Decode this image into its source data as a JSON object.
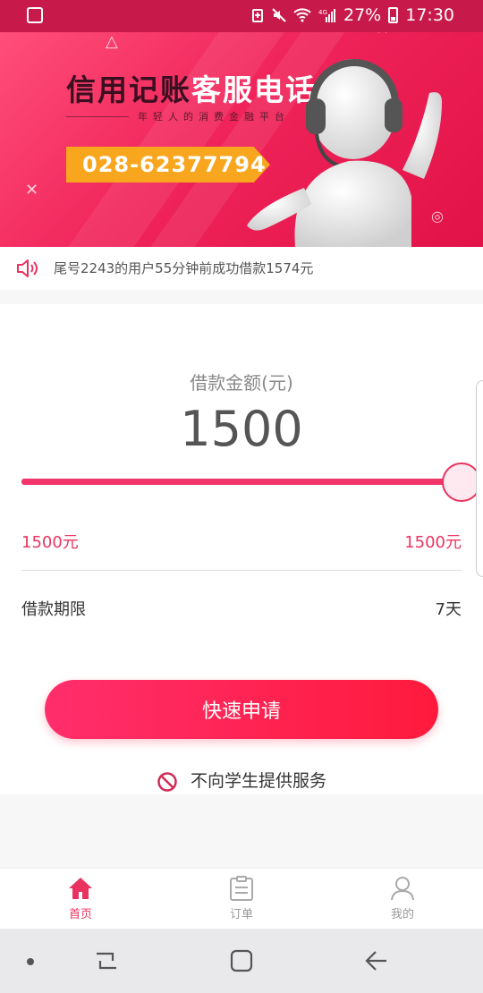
{
  "status_bar": {
    "battery": "27%",
    "time": "17:30"
  },
  "banner": {
    "title_a": "信用记账",
    "title_b": "客服电话",
    "subtitle": "年轻人的消费金融平台",
    "phone": "028-62377794"
  },
  "notice": {
    "icon": "speaker-icon",
    "text": "尾号2243的用户55分钟前成功借款1574元"
  },
  "loan": {
    "amount_label": "借款金额(元)",
    "amount": "1500",
    "slider_fraction": 1.0,
    "min_label": "1500元",
    "max_label": "1500元",
    "term_label": "借款期限",
    "term_value": "7天",
    "apply_button": "快速申请",
    "no_student_text": "不向学生提供服务"
  },
  "tabbar": {
    "items": [
      {
        "label": "首页",
        "icon": "home-icon",
        "active": true
      },
      {
        "label": "订单",
        "icon": "clipboard-icon",
        "active": false
      },
      {
        "label": "我的",
        "icon": "person-icon",
        "active": false
      }
    ]
  },
  "colors": {
    "accent": "#e9325f",
    "banner_bg": "#f0245a",
    "phone_tag": "#f8a61e"
  }
}
